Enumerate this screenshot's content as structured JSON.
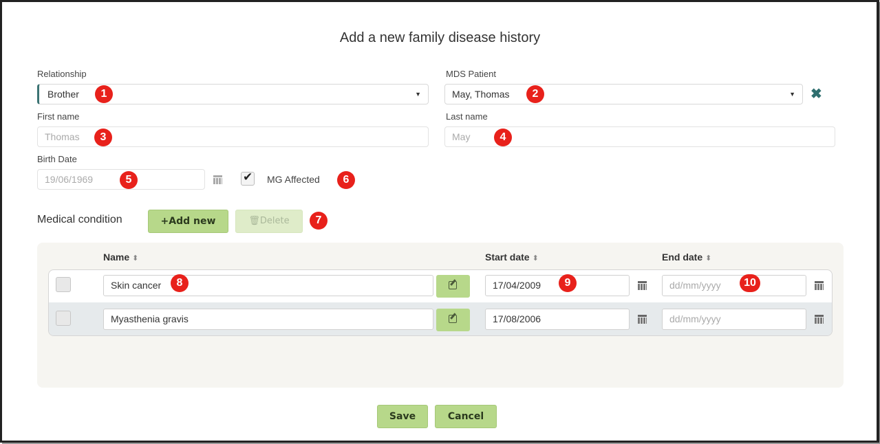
{
  "dialog": {
    "title": "Add a new family disease history"
  },
  "relationship": {
    "label": "Relationship",
    "value": "Brother"
  },
  "mds_patient": {
    "label": "MDS Patient",
    "value": "May, Thomas",
    "clear_icon": "close-icon"
  },
  "first_name": {
    "label": "First name",
    "value": "Thomas"
  },
  "last_name": {
    "label": "Last name",
    "value": "May"
  },
  "birth_date": {
    "label": "Birth Date",
    "value": "19/06/1969"
  },
  "mg_affected": {
    "label": "MG Affected",
    "checked": true
  },
  "medical_condition": {
    "label": "Medical condition",
    "add_label": "+Add new",
    "delete_label": "🗑Delete"
  },
  "table": {
    "columns": [
      "Name",
      "Start date",
      "End date"
    ],
    "rows": [
      {
        "name": "Skin cancer",
        "start": "17/04/2009",
        "end_placeholder": "dd/mm/yyyy"
      },
      {
        "name": "Myasthenia gravis",
        "start": "17/08/2006",
        "end_placeholder": "dd/mm/yyyy"
      }
    ]
  },
  "footer": {
    "save": "Save",
    "cancel": "Cancel"
  },
  "badges": [
    "1",
    "2",
    "3",
    "4",
    "5",
    "6",
    "7",
    "8",
    "9",
    "10"
  ],
  "colors": {
    "accent": "#b7d88a",
    "badge": "#e8211b",
    "teal": "#2f6f6f"
  }
}
